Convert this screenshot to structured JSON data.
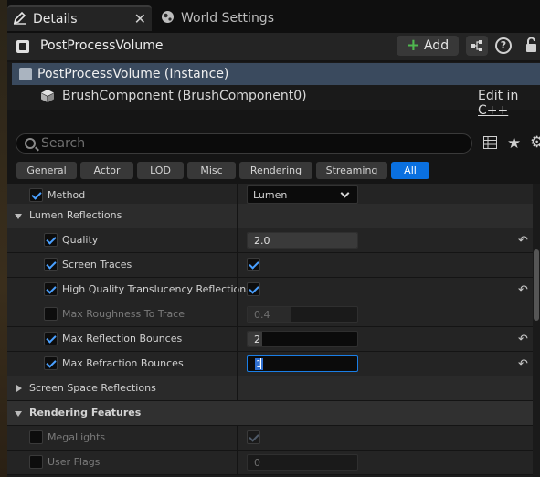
{
  "tabs": {
    "details_label": "Details",
    "world_settings_label": "World Settings"
  },
  "header": {
    "object_name": "PostProcessVolume",
    "add_label": "Add"
  },
  "tree": {
    "instance_label": "PostProcessVolume (Instance)",
    "component_label": "BrushComponent (BrushComponent0)",
    "edit_cpp_label": "Edit in C++"
  },
  "search": {
    "placeholder": "Search"
  },
  "filters": [
    "General",
    "Actor",
    "LOD",
    "Misc",
    "Rendering",
    "Streaming",
    "All"
  ],
  "active_filter": "All",
  "properties": {
    "method": {
      "label": "Method",
      "value": "Lumen"
    },
    "lumen_reflections": {
      "label": "Lumen Reflections"
    },
    "quality": {
      "label": "Quality",
      "value": "2.0"
    },
    "screen_traces": {
      "label": "Screen Traces"
    },
    "hq_translucency": {
      "label": "High Quality Translucency Reflections"
    },
    "max_roughness": {
      "label": "Max Roughness To Trace",
      "value": "0.4"
    },
    "max_reflection_bounces": {
      "label": "Max Reflection Bounces",
      "value": "2"
    },
    "max_refraction_bounces": {
      "label": "Max Refraction Bounces",
      "value": "1"
    },
    "screen_space_reflections": {
      "label": "Screen Space Reflections"
    },
    "rendering_features": {
      "label": "Rendering Features"
    },
    "megalights": {
      "label": "MegaLights"
    },
    "user_flags": {
      "label": "User Flags",
      "value": "0"
    }
  },
  "colors": {
    "accent": "#0a70e0",
    "selection": "#3a4a5e",
    "check": "#4aa0ff",
    "add_plus": "#4fb84f"
  }
}
